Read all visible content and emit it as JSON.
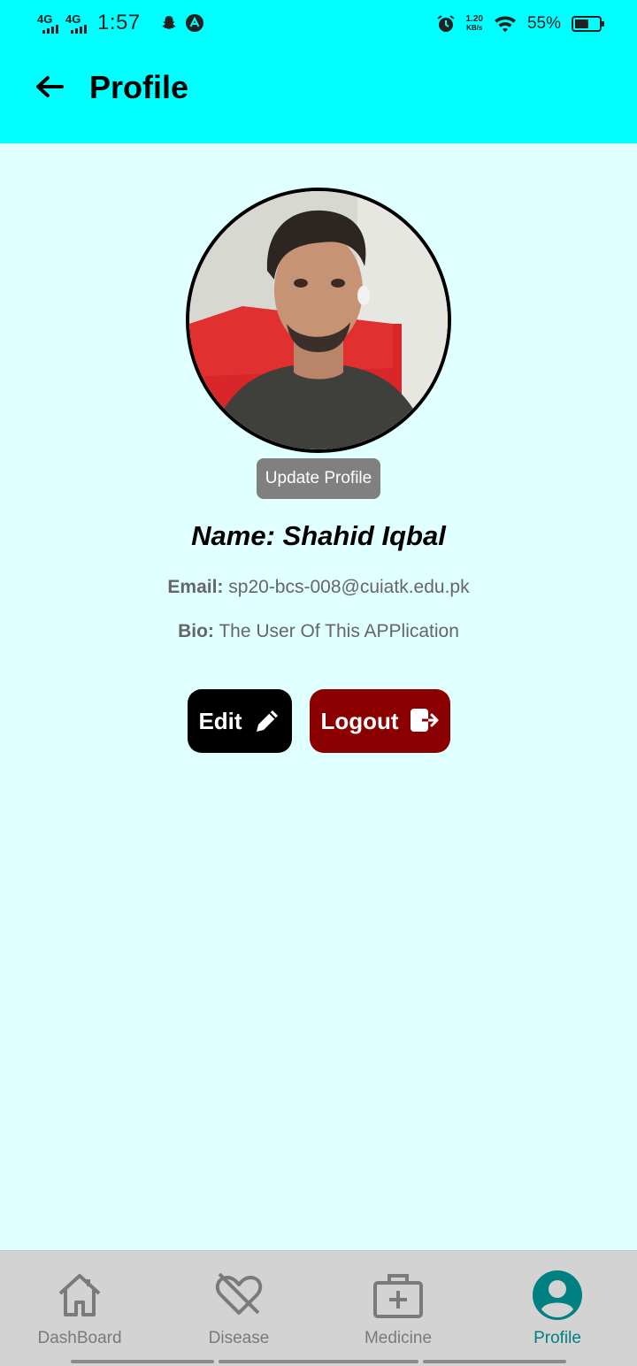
{
  "status_bar": {
    "network_1": "4G",
    "network_2": "4G",
    "time": "1:57",
    "speed_value": "1.20",
    "speed_unit": "KB/s",
    "battery_percent": "55%"
  },
  "appbar": {
    "title": "Profile",
    "back_icon": "arrow-left-icon"
  },
  "profile": {
    "update_button": "Update Profile",
    "name_text": "Name: Shahid Iqbal",
    "email_label": "Email:",
    "email_value": "sp20-bcs-008@cuiatk.edu.pk",
    "bio_label": "Bio:",
    "bio_value": "The User Of This APPlication"
  },
  "actions": {
    "edit_label": "Edit",
    "edit_icon": "pencil-icon",
    "logout_label": "Logout",
    "logout_icon": "logout-icon"
  },
  "bottom_nav": {
    "items": [
      {
        "label": "DashBoard",
        "icon": "home-icon",
        "active": false
      },
      {
        "label": "Disease",
        "icon": "heart-off-icon",
        "active": false
      },
      {
        "label": "Medicine",
        "icon": "medical-kit-icon",
        "active": false
      },
      {
        "label": "Profile",
        "icon": "account-circle-icon",
        "active": true
      }
    ]
  },
  "colors": {
    "header": "#00ffff",
    "background": "#e0ffff",
    "logout": "#8b0000",
    "active_tab": "#008080"
  }
}
